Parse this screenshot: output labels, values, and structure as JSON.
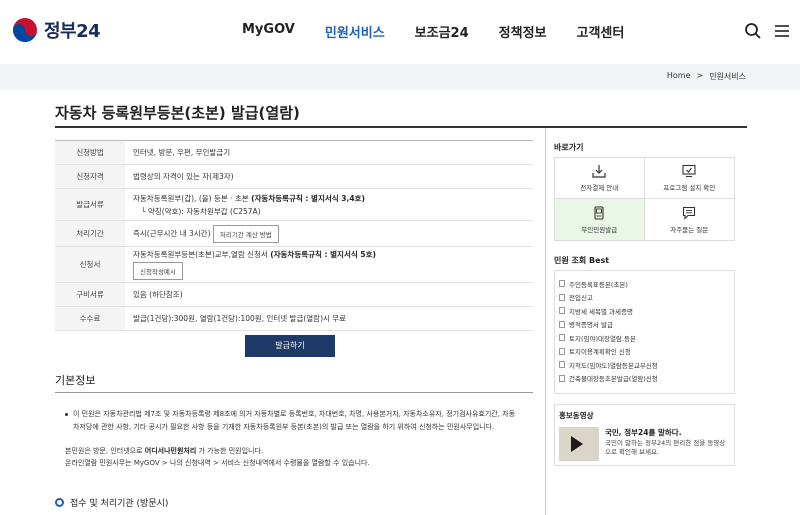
{
  "header": {
    "logo_text": "정부24",
    "nav": [
      "MyGOV",
      "민원서비스",
      "보조금24",
      "정책정보",
      "고객센터"
    ],
    "active_nav": "민원서비스"
  },
  "breadcrumb": {
    "home": "Home",
    "current": "민원서비스",
    "separator": ">"
  },
  "page_title": "자동차 등록원부등본(초본) 발급(열람)",
  "info": {
    "method_label": "신청방법",
    "method_value": "인터넷, 방문, 우편, 무인발급기",
    "qual_label": "신청자격",
    "qual_value": "법령상의 자격이 있는 자(제3자)",
    "form_label": "발급서류",
    "form_value_plain": "자동차등록원부(갑), (을) 등본 · 초본 ",
    "form_value_bold": "(자동차등록규칙 : 별지서식 3,4호)",
    "form_value_sub": "└ 약칭(약호): 자동차원부갑 (C257A)",
    "period_label": "처리기간",
    "period_value": "즉시(근무시간 내 3시간)",
    "period_btn": "처리기간 계산 방법",
    "app_label": "신청서",
    "app_value_plain": "자동차등록원부등본(초본)교부,열람 신청서 ",
    "app_value_bold": "(자동차등록규칙 : 별지서식 5호)",
    "app_btn": "신청작성예시",
    "docs_label": "구비서류",
    "docs_value": "있음 (하단참조)",
    "fee_label": "수수료",
    "fee_value": "발급(1건당):300원, 열람(1건당):100원, 인터넷 발급(열람)시 무료"
  },
  "issue_button": "발급하기",
  "basic": {
    "title": "기본정보",
    "para1": "이 민원은 자동차관리법 제7조 및 자동차등록령 제8조에 의거 자동차별로 등록번호, 차대번호, 차명, 사용본거지, 자동차소유자, 정기검사유효기간, 자동",
    "para1b": "차저당에 관한 사항, 기타 공시가 필요한 사항 등을 기재한 자동차등록원부 등본(초본)의 발급 또는 열람을 하기 위하여 신청하는 민원사무입니다.",
    "para2_pre": "본민원은 방문, 인터넷으로 ",
    "para2_bold": "어디서나민원처리",
    "para2_post": " 가 가능한 민원입니다.",
    "para3": "온라인열람 민원사무는 MyGOV > 나의 신청내역 > 서비스 신청내역에서 수령물을 열람할 수 있습니다."
  },
  "sub_section": "접수 및 처리기관 (방문시)",
  "side": {
    "quick_title": "바로가기",
    "quick": [
      "전자결제 안내",
      "프로그램 설치 확인",
      "무인민원발급",
      "자주묻는 질문"
    ],
    "best_title": "민원 조회 Best",
    "best": [
      "주민등록표등본(초본)",
      "전입신고",
      "지방세 세목별 과세증명",
      "병적증명서 발급",
      "토지(임야)대장열람.등본",
      "토지이용계획확인 신청",
      "지적도(임야도)열람등본교부신청",
      "건축물대장등초본발급(열람)신청"
    ],
    "video_title": "홍보동영상",
    "video_head": "국민, 정부24를 말하다.",
    "video_desc": "국민이 말하는 정부24의 편리한 점을 동영상으로 확인해 보세요."
  },
  "colors": {
    "accent": "#1e5fb3",
    "button": "#1f3a68",
    "highlight": "#eaf6e6"
  }
}
